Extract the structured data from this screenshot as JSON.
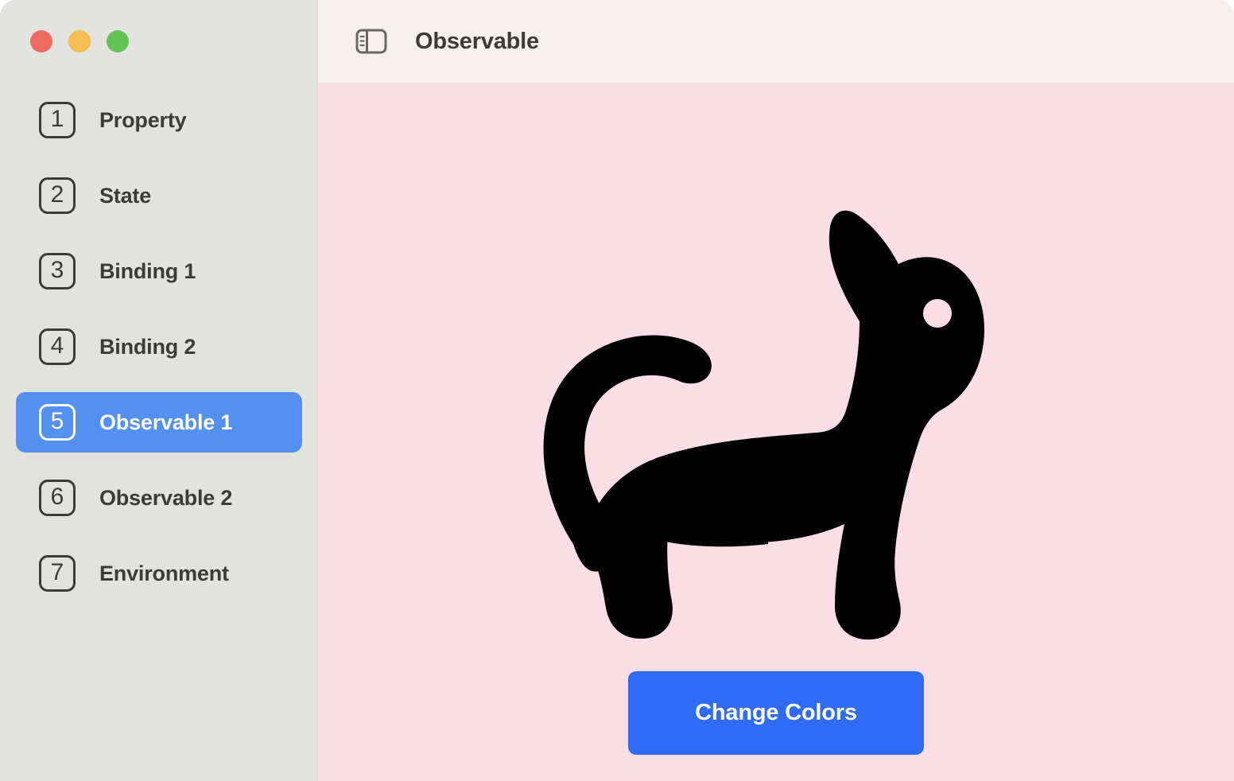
{
  "window": {
    "traffic_lights": [
      {
        "name": "close",
        "color": "#ec6a5f"
      },
      {
        "name": "minimize",
        "color": "#f4bd4f"
      },
      {
        "name": "maximize",
        "color": "#61c555"
      }
    ]
  },
  "sidebar": {
    "background": "#e2e3de",
    "selected_color": "#5490f0",
    "items": [
      {
        "number": "1",
        "label": "Property",
        "selected": false
      },
      {
        "number": "2",
        "label": "State",
        "selected": false
      },
      {
        "number": "3",
        "label": "Binding 1",
        "selected": false
      },
      {
        "number": "4",
        "label": "Binding 2",
        "selected": false
      },
      {
        "number": "5",
        "label": "Observable 1",
        "selected": true
      },
      {
        "number": "6",
        "label": "Observable 2",
        "selected": false
      },
      {
        "number": "7",
        "label": "Environment",
        "selected": false
      }
    ]
  },
  "toolbar": {
    "background": "#f6f1ee",
    "toggle_icon": "sidebar-toggle-icon",
    "title": "Observable"
  },
  "content": {
    "background": "#fbdde6",
    "illustration": {
      "name": "cat-silhouette",
      "fill": "#000000",
      "eye_fill": "#fbdde6"
    },
    "button": {
      "label": "Change Colors",
      "background": "#2f6bf5",
      "text_color": "#ffffff"
    }
  }
}
